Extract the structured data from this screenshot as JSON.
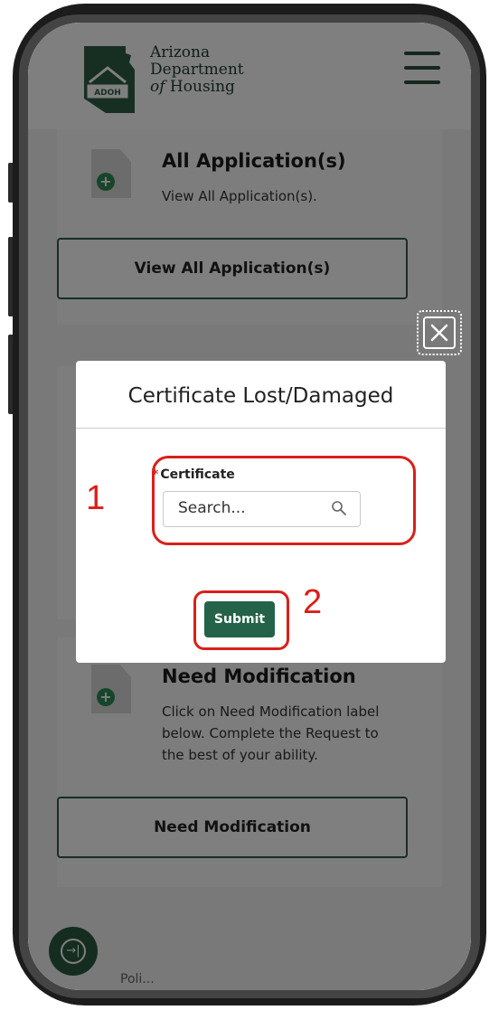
{
  "header": {
    "logo_badge": "ADOH",
    "logo_line1": "Arizona",
    "logo_line2": "Department",
    "logo_line3_italic": "of",
    "logo_line3_rest": " Housing",
    "menu_icon": "hamburger-menu-icon"
  },
  "cards": {
    "all_apps": {
      "title": "All Application(s)",
      "desc": "View All Application(s).",
      "button": "View All Application(s)"
    },
    "need_mod": {
      "title": "Need Modification",
      "desc_line1": "Click on Need Modification label",
      "desc_line2": "below. Complete the Request to",
      "desc_line3": "the best of your ability.",
      "button": "Need Modification"
    },
    "bottom_peek": "Poli..."
  },
  "modal": {
    "title": "Certificate Lost/Damaged",
    "field_required_marker": "*",
    "field_label": "Certificate",
    "search_placeholder": "Search...",
    "submit_label": "Submit",
    "close_icon": "close-icon"
  },
  "annotations": {
    "step1": "1",
    "step2": "2",
    "highlight_color": "#d9201a"
  },
  "colors": {
    "brand_green": "#24634a",
    "accent_green": "#2e8b57"
  }
}
